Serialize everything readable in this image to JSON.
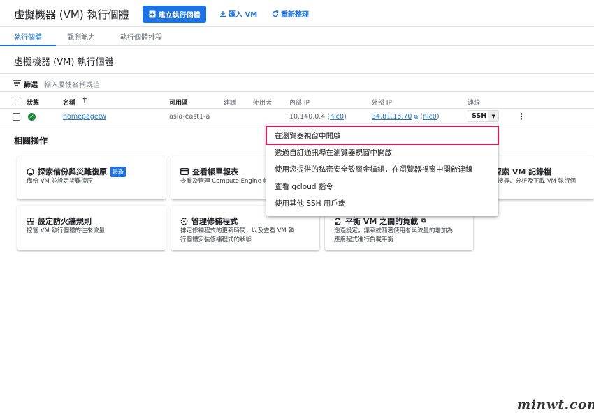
{
  "header": {
    "title": "虛擬機器 (VM) 執行個體",
    "create_label": "建立執行個體",
    "import_label": "匯入 VM",
    "refresh_label": "重新整理"
  },
  "tabs": [
    {
      "label": "執行個體",
      "active": true
    },
    {
      "label": "觀測能力",
      "active": false
    },
    {
      "label": "執行個體排程",
      "active": false
    }
  ],
  "section_title": "虛擬機器 (VM) 執行個體",
  "filter": {
    "label": "篩選",
    "placeholder": "輸入屬性名稱或值"
  },
  "table": {
    "columns": [
      "狀態",
      "名稱",
      "可用區",
      "建議",
      "使用者",
      "內部 IP",
      "外部 IP",
      "連線"
    ],
    "sort_indicator": "↑",
    "rows": [
      {
        "name": "homepagetw",
        "zone": "asia-east1-a",
        "internal_ip": "10.140.0.4",
        "internal_nic": "nic0",
        "external_ip": "34.81.15.70",
        "external_nic": "nic0",
        "connect": "SSH"
      }
    ]
  },
  "related": {
    "title": "相關操作",
    "cards": [
      {
        "title": "探索備份與災難復原",
        "badge": "最新",
        "desc": [
          "備份 VM 並設定災難復原"
        ]
      },
      {
        "title": "查看帳單報表",
        "desc": [
          "查看及管理 Compute Engine 帳"
        ]
      },
      {
        "title": "探索 VM 記錄檔",
        "desc": [
          "搜尋、分析及下載 VM 執行個"
        ]
      },
      {
        "title": "設定防火牆規則",
        "desc": [
          "控管 VM 執行個體的往來流量"
        ]
      },
      {
        "title": "管理修補程式",
        "desc": [
          "排定修補程式的更新時間，以及查看 VM 執",
          "行個體安裝修補程式的狀態"
        ]
      },
      {
        "title": "平衡 VM 之間的負載",
        "desc": [
          "透過設定，讓系統隨著使用者與流量的增加為",
          "應用程式進行負載平衡"
        ]
      }
    ]
  },
  "ssh_menu": {
    "items": [
      "在瀏覽器視窗中開啟",
      "透過自訂通訊埠在瀏覽器視窗中開啟",
      "使用您提供的私密安全殼層金鑰組，在瀏覽器視窗中開啟連線",
      "查看 gcloud 指令",
      "使用其他 SSH 用戶端"
    ]
  },
  "watermark": "minwt.com",
  "colors": {
    "accent": "#1a73e8",
    "highlight": "#d81b60",
    "status_ok": "#1e8e3e"
  }
}
